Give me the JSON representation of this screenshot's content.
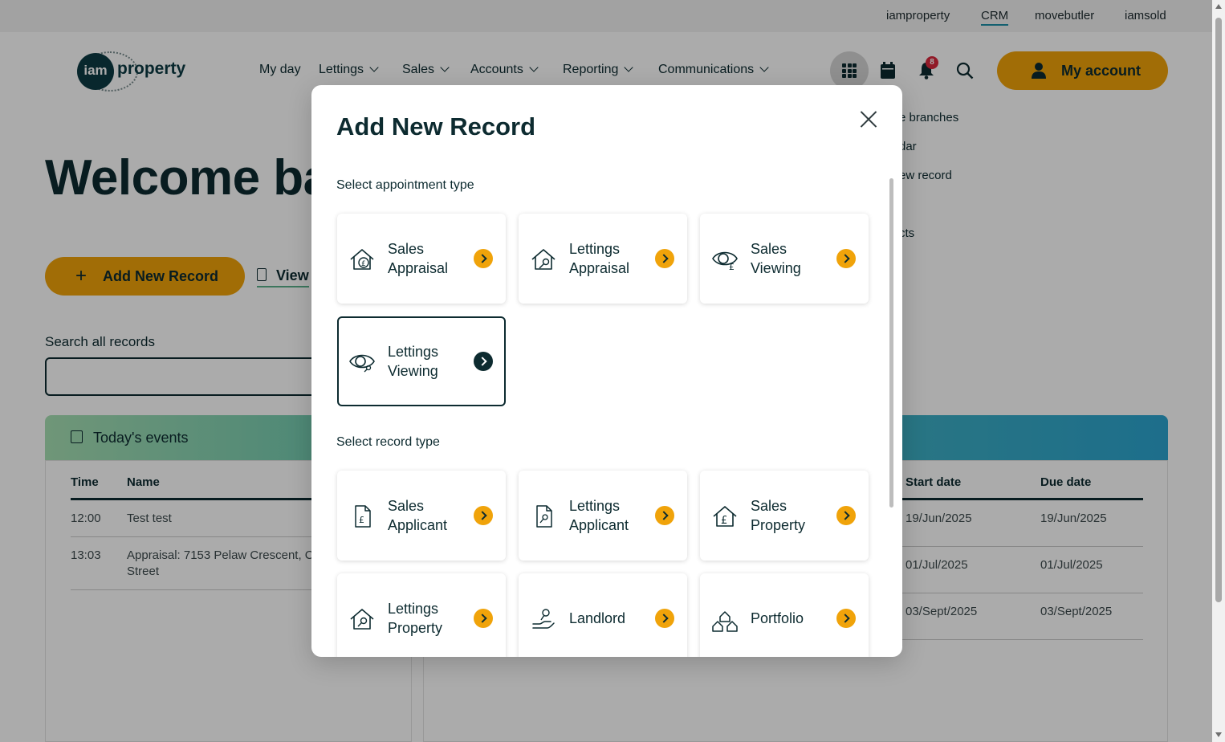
{
  "topbar": {
    "links": [
      "iamproperty",
      "CRM",
      "movebutler",
      "iamsold"
    ],
    "active": "CRM"
  },
  "brand": {
    "logo_circle": "iam",
    "logo_text": "property"
  },
  "nav": {
    "items": [
      "My day",
      "Lettings",
      "Sales",
      "Accounts",
      "Reporting",
      "Communications"
    ]
  },
  "header": {
    "notification_count": "8",
    "my_account_label": "My account"
  },
  "dropdown": {
    "items": [
      "e branches",
      "dar",
      "ew record",
      "cts"
    ]
  },
  "page": {
    "welcome_text": "Welcome ba",
    "add_new_record_label": "Add New Record",
    "view_label": "View",
    "search_label": "Search all records",
    "events_title": "Today's events"
  },
  "events_table": {
    "headers": [
      "Time",
      "Name"
    ],
    "rows": [
      {
        "time": "12:00",
        "name": "Test test"
      },
      {
        "time": "13:03",
        "name": "Appraisal: 7153 Pelaw Crescent, C",
        "name_line2": "Street"
      }
    ]
  },
  "tasks_table": {
    "headers": [
      "Start date",
      "Due date"
    ],
    "rows": [
      {
        "start": "19/Jun/2025",
        "due": "19/Jun/2025"
      },
      {
        "start": "01/Jul/2025",
        "due": "01/Jul/2025"
      },
      {
        "start": "03/Sept/2025",
        "due": "03/Sept/2025"
      }
    ]
  },
  "modal": {
    "title": "Add New Record",
    "appointment_section": "Select appointment type",
    "record_section": "Select record type",
    "appointment_tiles": [
      {
        "line1": "Sales",
        "line2": "Appraisal",
        "icon": "house-pound-icon"
      },
      {
        "line1": "Lettings",
        "line2": "Appraisal",
        "icon": "house-key-icon"
      },
      {
        "line1": "Sales",
        "line2": "Viewing",
        "icon": "eye-pound-icon"
      },
      {
        "line1": "Lettings",
        "line2": "Viewing",
        "icon": "eye-key-icon",
        "selected": true
      }
    ],
    "record_tiles": [
      {
        "line1": "Sales",
        "line2": "Applicant",
        "icon": "document-pound-icon"
      },
      {
        "line1": "Lettings",
        "line2": "Applicant",
        "icon": "document-key-icon"
      },
      {
        "line1": "Sales",
        "line2": "Property",
        "icon": "house-pound-icon"
      },
      {
        "line1": "Lettings",
        "line2": "Property",
        "icon": "house-key-icon"
      },
      {
        "line1": "Landlord",
        "line2": "",
        "icon": "hand-key-icon"
      },
      {
        "line1": "Portfolio",
        "line2": "",
        "icon": "houses-icon"
      }
    ]
  },
  "colors": {
    "accent": "#f0a30a",
    "dark": "#0d2b30",
    "link_underline": "#1f8fa8",
    "badge": "#d8283c"
  }
}
